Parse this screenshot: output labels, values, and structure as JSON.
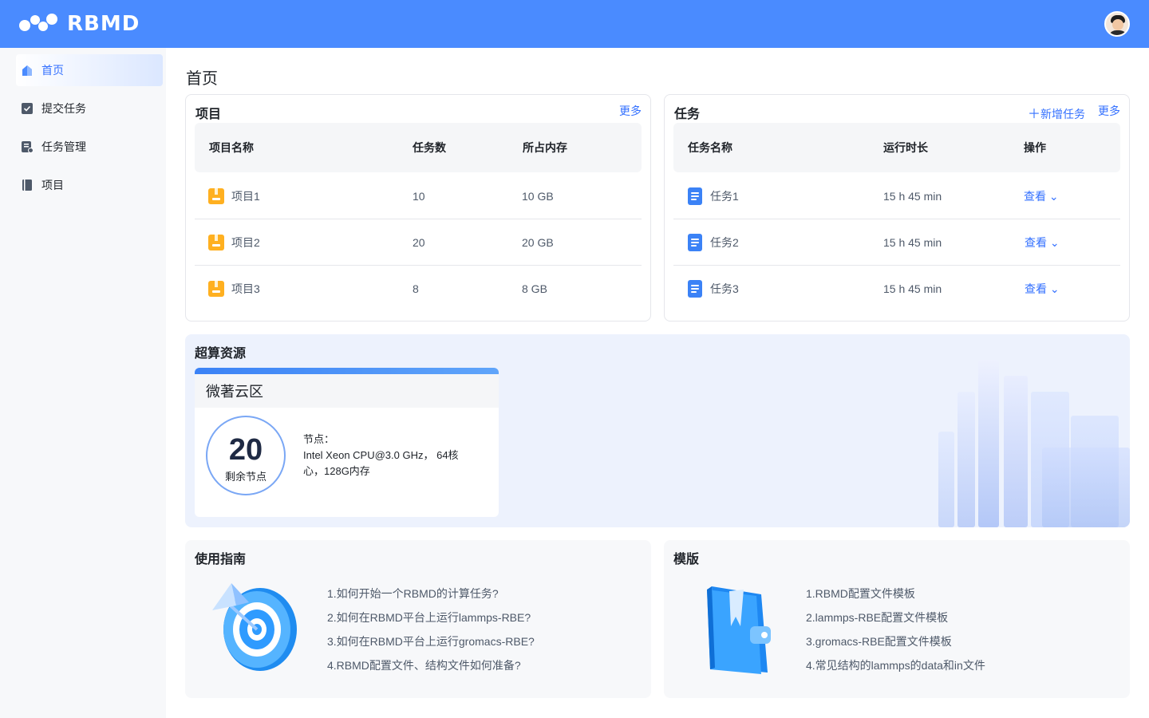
{
  "app": {
    "logo_text": "RBMD"
  },
  "sidebar": {
    "items": [
      {
        "label": "首页",
        "icon": "home-icon",
        "active": true
      },
      {
        "label": "提交任务",
        "icon": "submit-task-icon",
        "active": false
      },
      {
        "label": "任务管理",
        "icon": "task-manage-icon",
        "active": false
      },
      {
        "label": "项目",
        "icon": "book-icon",
        "active": false
      }
    ]
  },
  "page": {
    "title": "首页"
  },
  "projects": {
    "title": "项目",
    "more": "更多",
    "columns": [
      "项目名称",
      "任务数",
      "所占内存"
    ],
    "rows": [
      {
        "name": "项目1",
        "tasks": "10",
        "memory": "10 GB"
      },
      {
        "name": "项目2",
        "tasks": "20",
        "memory": "20 GB"
      },
      {
        "name": "项目3",
        "tasks": "8",
        "memory": "8 GB"
      }
    ]
  },
  "tasks": {
    "title": "任务",
    "add": "新增任务",
    "more": "更多",
    "columns": [
      "任务名称",
      "运行时长",
      "操作"
    ],
    "rows": [
      {
        "name": "任务1",
        "duration": "15 h 45 min",
        "action": "查看"
      },
      {
        "name": "任务2",
        "duration": "15 h 45 min",
        "action": "查看"
      },
      {
        "name": "任务3",
        "duration": "15 h 45 min",
        "action": "查看"
      }
    ]
  },
  "resources": {
    "title": "超算资源",
    "card": {
      "name": "微著云区",
      "remaining": "20",
      "remaining_label": "剩余节点",
      "node_label": "节点：",
      "node_desc": "Intel Xeon CPU@3.0 GHz， 64核心，128G内存"
    }
  },
  "guide": {
    "title": "使用指南",
    "items": [
      "1.如何开始一个RBMD的计算任务?",
      "2.如何在RBMD平台上运行lammps-RBE?",
      "3.如何在RBMD平台上运行gromacs-RBE?",
      "4.RBMD配置文件、结构文件如何准备?"
    ]
  },
  "templates": {
    "title": "模版",
    "items": [
      "1.RBMD配置文件模板",
      "2.lammps-RBE配置文件模板",
      "3.gromacs-RBE配置文件模板",
      "4.常见结构的lammps的data和in文件"
    ]
  },
  "colors": {
    "header": "#4a8bff",
    "accent": "#3370ff",
    "folder": "#ffb020",
    "doc": "#3b82f6"
  }
}
